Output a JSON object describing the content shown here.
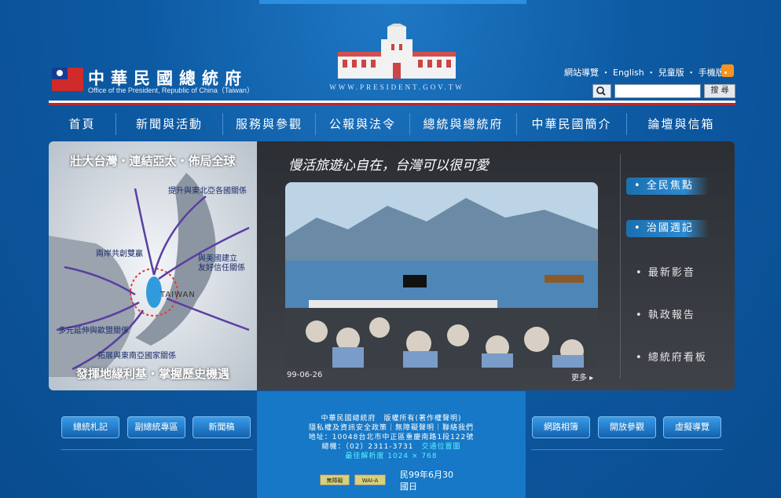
{
  "header": {
    "title": "中華民國總統府",
    "subtitle": "Office of the President, Republic of China（Taiwan）",
    "url_text": "WWW.PRESIDENT.GOV.TW",
    "links": [
      "網站導覽",
      "English",
      "兒童版",
      "手機版"
    ],
    "search_button": "搜 尋",
    "search_placeholder": ""
  },
  "nav": {
    "items": [
      "首頁",
      "新聞與活動",
      "服務與參觀",
      "公報與法令",
      "總統與總統府",
      "中華民國簡介",
      "論壇與信箱"
    ]
  },
  "promo": {
    "title": "壯大台灣・連結亞太・佈局全球",
    "bottom": "發揮地緣利基・掌握歷史機遇",
    "labels": [
      "提升與東北亞各國關係",
      "兩岸共創雙贏",
      "與美國建立",
      "友好信任關係",
      "TAIWAN",
      "多元延伸與歐盟關係",
      "拓展與東南亞國家關係"
    ]
  },
  "main": {
    "headline": "慢活旅遊心自在，台灣可以很可愛",
    "date": "99-06-26",
    "more": "更多",
    "side_items": [
      "全民焦點",
      "治國週記",
      "最新影音",
      "執政報告",
      "總統府看板"
    ]
  },
  "bottom": {
    "left_buttons": [
      "總統札記",
      "副總統專區",
      "新聞稿"
    ],
    "right_buttons": [
      "網路相簿",
      "開放參觀",
      "虛擬導覽"
    ]
  },
  "footer": {
    "line1": "中華民國總統府　版權所有(著作權聲明)",
    "line2": "隱私權及資訊安全政策｜無障礙聲明｜聯絡我們",
    "line3": "地址：10048台北市中正區重慶南路1段122號",
    "line4a": "總機：（02）2311-3731　",
    "line4b": "交通位置圖",
    "line5": "最佳解析度 1024 × 768",
    "badge1": "無障礙",
    "badge2": "WAI-A",
    "date1": "民99年6月30",
    "date2": "國日"
  },
  "colors": {
    "background": "#0d5aa3",
    "nav_divider": "#4d8fd1",
    "accent_red": "#c0262c",
    "panel_dark": "#2b2e33",
    "highlight_cyan": "#5ef0ff"
  }
}
